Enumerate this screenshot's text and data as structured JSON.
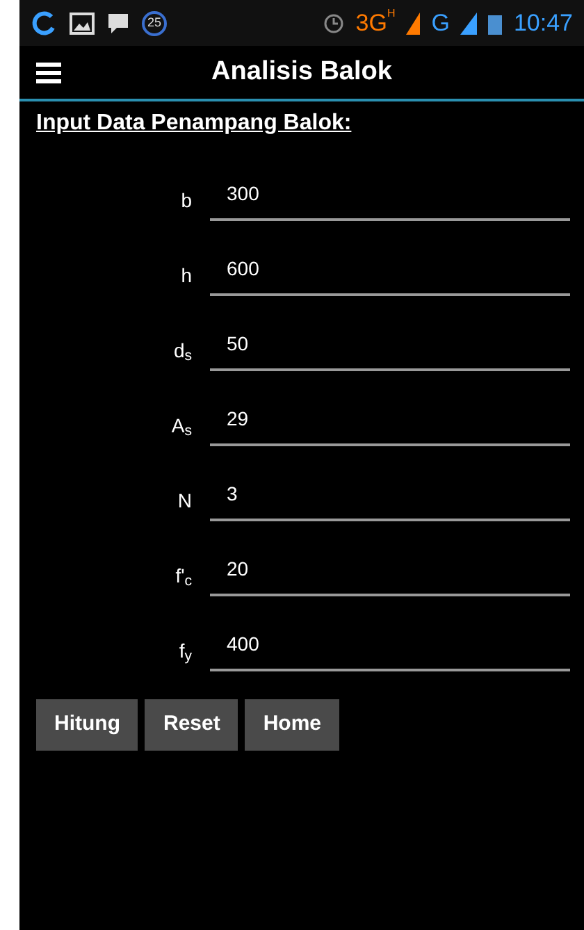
{
  "status_bar": {
    "notification_count": "25",
    "network_3g": "3G",
    "network_h": "H",
    "network_g": "G",
    "time": "10:47"
  },
  "app_bar": {
    "title": "Analisis Balok"
  },
  "section_title": "Input Data Penampang Balok:",
  "fields": [
    {
      "label": "b",
      "value": "300"
    },
    {
      "label": "h",
      "value": "600"
    },
    {
      "label": "d$_{s}$",
      "value": "50"
    },
    {
      "label": "A$_{s}$",
      "value": "29"
    },
    {
      "label": "N",
      "value": "3"
    },
    {
      "label": "f'$_{c}$",
      "value": "20"
    },
    {
      "label": "f$_{y}$",
      "value": "400"
    }
  ],
  "buttons": [
    "Hitung",
    "Reset",
    "Home"
  ]
}
